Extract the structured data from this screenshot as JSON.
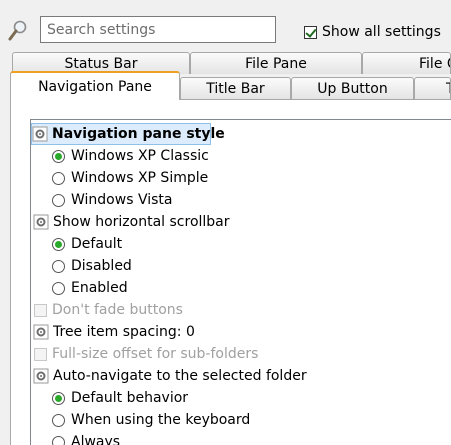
{
  "search": {
    "placeholder": "Search settings"
  },
  "show_all": {
    "label": "Show all settings",
    "checked": true
  },
  "tabs": {
    "row1": [
      {
        "label": "Status Bar"
      },
      {
        "label": "File Pane"
      },
      {
        "label": "File C"
      }
    ],
    "row2": [
      {
        "label": "Navigation Pane",
        "active": true
      },
      {
        "label": "Title Bar"
      },
      {
        "label": "Up Button"
      },
      {
        "label": "T"
      }
    ]
  },
  "settings": [
    {
      "type": "setting",
      "label": "Navigation pane style",
      "selected": true
    },
    {
      "type": "radio",
      "label": "Windows XP Classic",
      "checked": true
    },
    {
      "type": "radio",
      "label": "Windows XP Simple",
      "checked": false
    },
    {
      "type": "radio",
      "label": "Windows Vista",
      "checked": false
    },
    {
      "type": "setting",
      "label": "Show horizontal scrollbar"
    },
    {
      "type": "radio",
      "label": "Default",
      "checked": true
    },
    {
      "type": "radio",
      "label": "Disabled",
      "checked": false
    },
    {
      "type": "radio",
      "label": "Enabled",
      "checked": false
    },
    {
      "type": "checkbox",
      "label": "Don't fade buttons",
      "disabled": true
    },
    {
      "type": "setting",
      "label": "Tree item spacing: 0"
    },
    {
      "type": "checkbox",
      "label": "Full-size offset for sub-folders",
      "disabled": true
    },
    {
      "type": "setting",
      "label": "Auto-navigate to the selected folder"
    },
    {
      "type": "radio",
      "label": "Default behavior",
      "checked": true
    },
    {
      "type": "radio",
      "label": "When using the keyboard",
      "checked": false
    },
    {
      "type": "radio",
      "label": "Always",
      "checked": false
    }
  ]
}
